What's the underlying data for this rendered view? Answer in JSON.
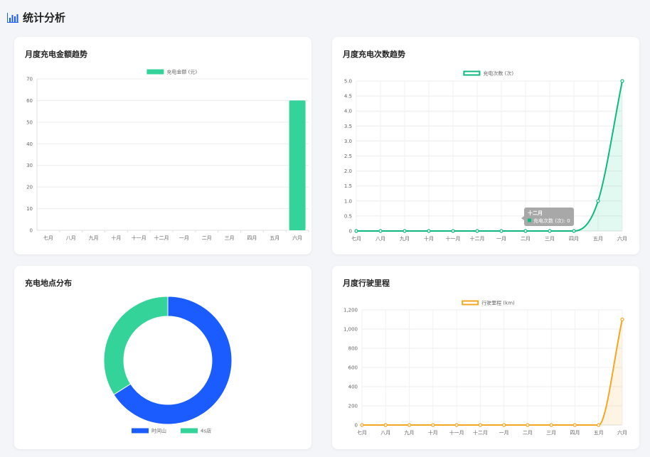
{
  "page": {
    "title": "统计分析",
    "icon": "bar-chart-icon"
  },
  "colors": {
    "green": "#34d399",
    "green_line": "#10b981",
    "blue": "#1a5cff",
    "orange": "#f5a623",
    "tooltip_bg": "#9e9e9e"
  },
  "months": [
    "七月",
    "八月",
    "九月",
    "十月",
    "十一月",
    "十二月",
    "一月",
    "二月",
    "三月",
    "四月",
    "五月",
    "六月"
  ],
  "chart_data": [
    {
      "id": "amount",
      "type": "bar",
      "title": "月度充电金额趋势",
      "categories": [
        "七月",
        "八月",
        "九月",
        "十月",
        "十一月",
        "十二月",
        "一月",
        "二月",
        "三月",
        "四月",
        "五月",
        "六月"
      ],
      "series": [
        {
          "name": "充电金额 (元)",
          "values": [
            0,
            0,
            0,
            0,
            0,
            0,
            0,
            0,
            0,
            0,
            0,
            60
          ]
        }
      ],
      "ylim": [
        0,
        70
      ],
      "yticks": [
        "0",
        "10",
        "20",
        "30",
        "40",
        "50",
        "60",
        "70"
      ],
      "legend": "top-center",
      "grid": true
    },
    {
      "id": "count",
      "type": "line",
      "title": "月度充电次数趋势",
      "categories": [
        "七月",
        "八月",
        "九月",
        "十月",
        "十一月",
        "十二月",
        "一月",
        "二月",
        "三月",
        "四月",
        "五月",
        "六月"
      ],
      "series": [
        {
          "name": "充电次数 (次)",
          "values": [
            0,
            0,
            0,
            0,
            0,
            0,
            0,
            0,
            0,
            0,
            1,
            5
          ]
        }
      ],
      "ylim": [
        0,
        5
      ],
      "yticks": [
        "0",
        "0.5",
        "1.0",
        "1.5",
        "2.0",
        "2.5",
        "3.0",
        "3.5",
        "4.0",
        "4.5",
        "5.0"
      ],
      "legend": "top-center",
      "grid": true,
      "tooltip": {
        "title": "十二月",
        "label": "充电次数 (次): 0"
      }
    },
    {
      "id": "location",
      "type": "pie",
      "title": "充电地点分布",
      "labels": [
        "时间山",
        "4s店"
      ],
      "values": [
        66,
        34
      ],
      "legend": "bottom-center"
    },
    {
      "id": "mileage",
      "type": "line",
      "title": "月度行驶里程",
      "categories": [
        "七月",
        "八月",
        "九月",
        "十月",
        "十一月",
        "十二月",
        "一月",
        "二月",
        "三月",
        "四月",
        "五月",
        "六月"
      ],
      "series": [
        {
          "name": "行驶里程 (km)",
          "values": [
            0,
            0,
            0,
            0,
            0,
            0,
            0,
            0,
            0,
            0,
            0,
            1100
          ]
        }
      ],
      "ylim": [
        0,
        1200
      ],
      "yticks": [
        "0",
        "200",
        "400",
        "600",
        "800",
        "1,000",
        "1,200"
      ],
      "legend": "top-center",
      "grid": true
    }
  ]
}
